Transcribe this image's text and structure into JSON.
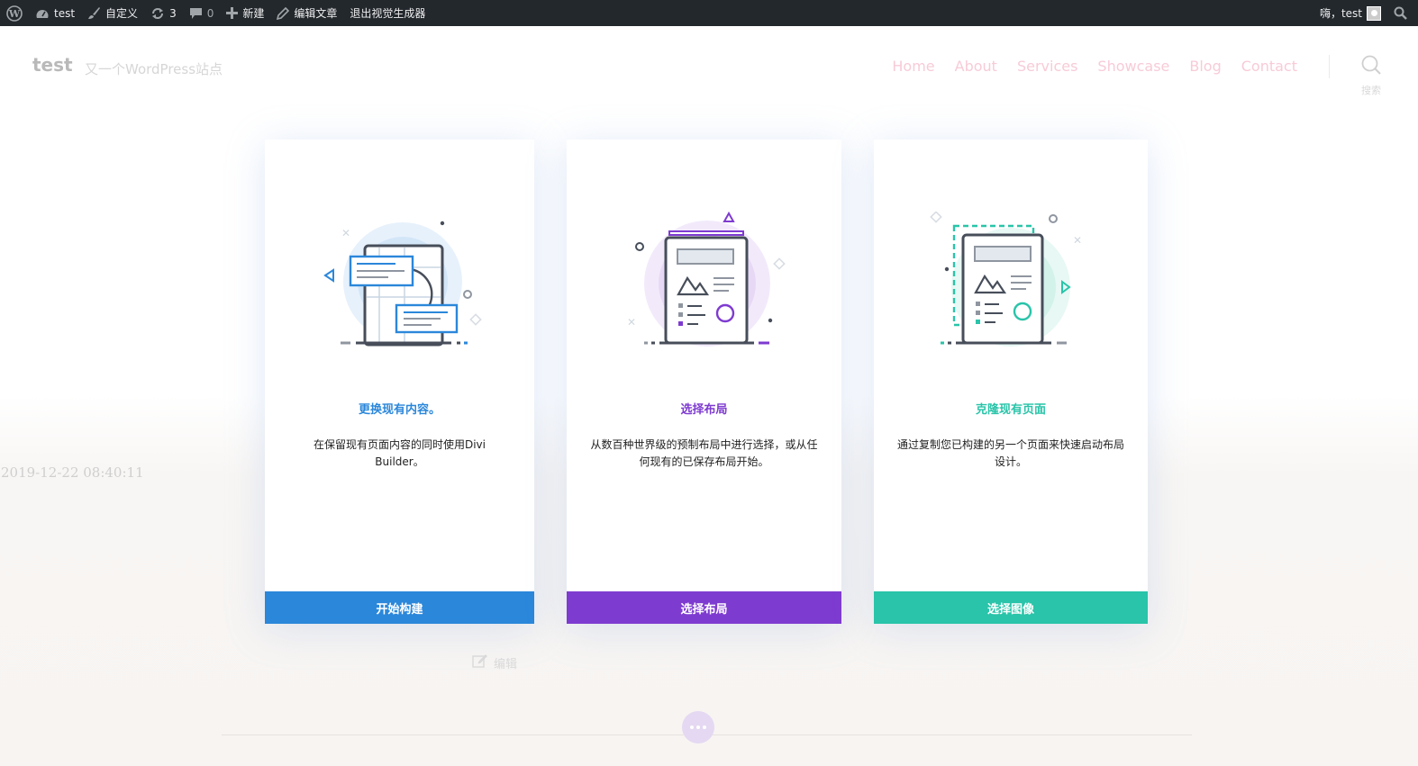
{
  "adminbar": {
    "site_name": "test",
    "customize": "自定义",
    "updates_count": "3",
    "comments_count": "0",
    "new_label": "新建",
    "edit_post": "编辑文章",
    "exit_builder": "退出视觉生成器",
    "greeting": "嗨，test"
  },
  "site": {
    "title": "test",
    "tagline": "又一个WordPress站点",
    "menu": [
      "Home",
      "About",
      "Services",
      "Showcase",
      "Blog",
      "Contact"
    ],
    "search_label": "搜索",
    "date": "2019-12-22 08:40:11",
    "edit_label": "编辑"
  },
  "cards": [
    {
      "title": "更换现有内容。",
      "description": "在保留现有页面内容的同时使用Divi Builder。",
      "button": "开始构建",
      "color": "#2b87da"
    },
    {
      "title": "选择布局",
      "description": "从数百种世界级的预制布局中进行选择，或从任何现有的已保存布局开始。",
      "button": "选择布局",
      "color": "#7e3bd0"
    },
    {
      "title": "克隆现有页面",
      "description": "通过复制您已构建的另一个页面来快速启动布局设计。",
      "button": "选择图像",
      "color": "#29c4a9"
    }
  ],
  "colors": {
    "adminbar_bg": "#23282d",
    "menu_link": "#f7cbd7"
  },
  "icons": [
    "wordpress-icon",
    "dashboard-icon",
    "brush-icon",
    "updates-icon",
    "comments-icon",
    "plus-icon",
    "pencil-icon",
    "search-icon",
    "edit-icon",
    "more-dots-icon"
  ]
}
